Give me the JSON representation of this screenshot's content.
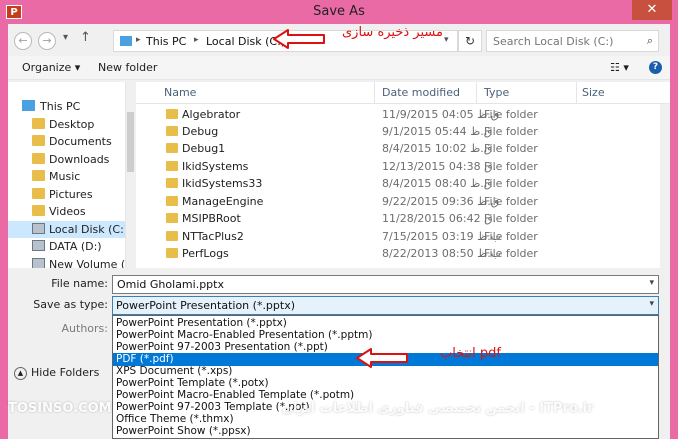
{
  "window": {
    "title": "Save As",
    "app_icon": "P",
    "close": "✕"
  },
  "address": {
    "segments": [
      "This PC",
      "Local Disk (C:)"
    ],
    "search_placeholder": "Search Local Disk (C:)"
  },
  "toolbar": {
    "organize": "Organize ▾",
    "new_folder": "New folder",
    "view": "☷ ▾"
  },
  "nav": {
    "items": [
      {
        "label": "This PC",
        "icon": "pc-icon"
      },
      {
        "label": "Desktop",
        "icon": "folder-icon"
      },
      {
        "label": "Documents",
        "icon": "folder-icon"
      },
      {
        "label": "Downloads",
        "icon": "folder-icon"
      },
      {
        "label": "Music",
        "icon": "folder-icon"
      },
      {
        "label": "Pictures",
        "icon": "folder-icon"
      },
      {
        "label": "Videos",
        "icon": "folder-icon"
      },
      {
        "label": "Local Disk (C:)",
        "icon": "disk-icon",
        "selected": true
      },
      {
        "label": "DATA (D:)",
        "icon": "disk-icon"
      },
      {
        "label": "New Volume (E:)",
        "icon": "disk-icon"
      }
    ]
  },
  "filelist": {
    "columns": [
      "Name",
      "Date modified",
      "Type",
      "Size"
    ],
    "rows": [
      {
        "name": "Algebrator",
        "date": "11/9/2015 04:05 ق.ظ",
        "type": "File folder"
      },
      {
        "name": "Debug",
        "date": "9/1/2015 05:44 ق.ظ",
        "type": "File folder"
      },
      {
        "name": "Debug1",
        "date": "8/4/2015 10:02 ق.ظ",
        "type": "File folder"
      },
      {
        "name": "IkidSystems",
        "date": "12/13/2015 04:38 ق.",
        "type": "File folder"
      },
      {
        "name": "IkidSystems33",
        "date": "8/4/2015 08:40 ق.ظ",
        "type": "File folder"
      },
      {
        "name": "ManageEngine",
        "date": "9/22/2015 09:36 ق.ظ",
        "type": "File folder"
      },
      {
        "name": "MSIPBRoot",
        "date": "11/28/2015 06:42 ق.",
        "type": "File folder"
      },
      {
        "name": "NTTacPlus2",
        "date": "7/15/2015 03:19 ب.ظ",
        "type": "File folder"
      },
      {
        "name": "PerfLogs",
        "date": "8/22/2013 08:50 ب.ظ",
        "type": "File folder"
      }
    ]
  },
  "form": {
    "file_name_label": "File name:",
    "file_name_value": "Omid Gholami.pptx",
    "save_type_label": "Save as type:",
    "save_type_value": "PowerPoint Presentation (*.pptx)",
    "authors_label": "Authors:",
    "hide_folders": "Hide Folders"
  },
  "dropdown": {
    "options": [
      "PowerPoint Presentation (*.pptx)",
      "PowerPoint Macro-Enabled Presentation (*.pptm)",
      "PowerPoint 97-2003 Presentation (*.ppt)",
      "PDF (*.pdf)",
      "XPS Document (*.xps)",
      "PowerPoint Template (*.potx)",
      "PowerPoint Macro-Enabled Template (*.potm)",
      "PowerPoint 97-2003 Template (*.pot)",
      "Office Theme (*.thmx)",
      "PowerPoint Show (*.ppsx)"
    ],
    "selected_index": 3
  },
  "annotations": {
    "path_note": "مسیر ذخیره سازی",
    "pdf_note": "انتخاب pdf"
  },
  "watermark": {
    "left": "TOSINSO.COM",
    "right": "انجمن تخصصی فناوری اطلاعات ایران - ITPro.ir"
  },
  "colors": {
    "frame": "#e96aa4",
    "selection": "#0078d7",
    "annotation": "#dd1111"
  }
}
